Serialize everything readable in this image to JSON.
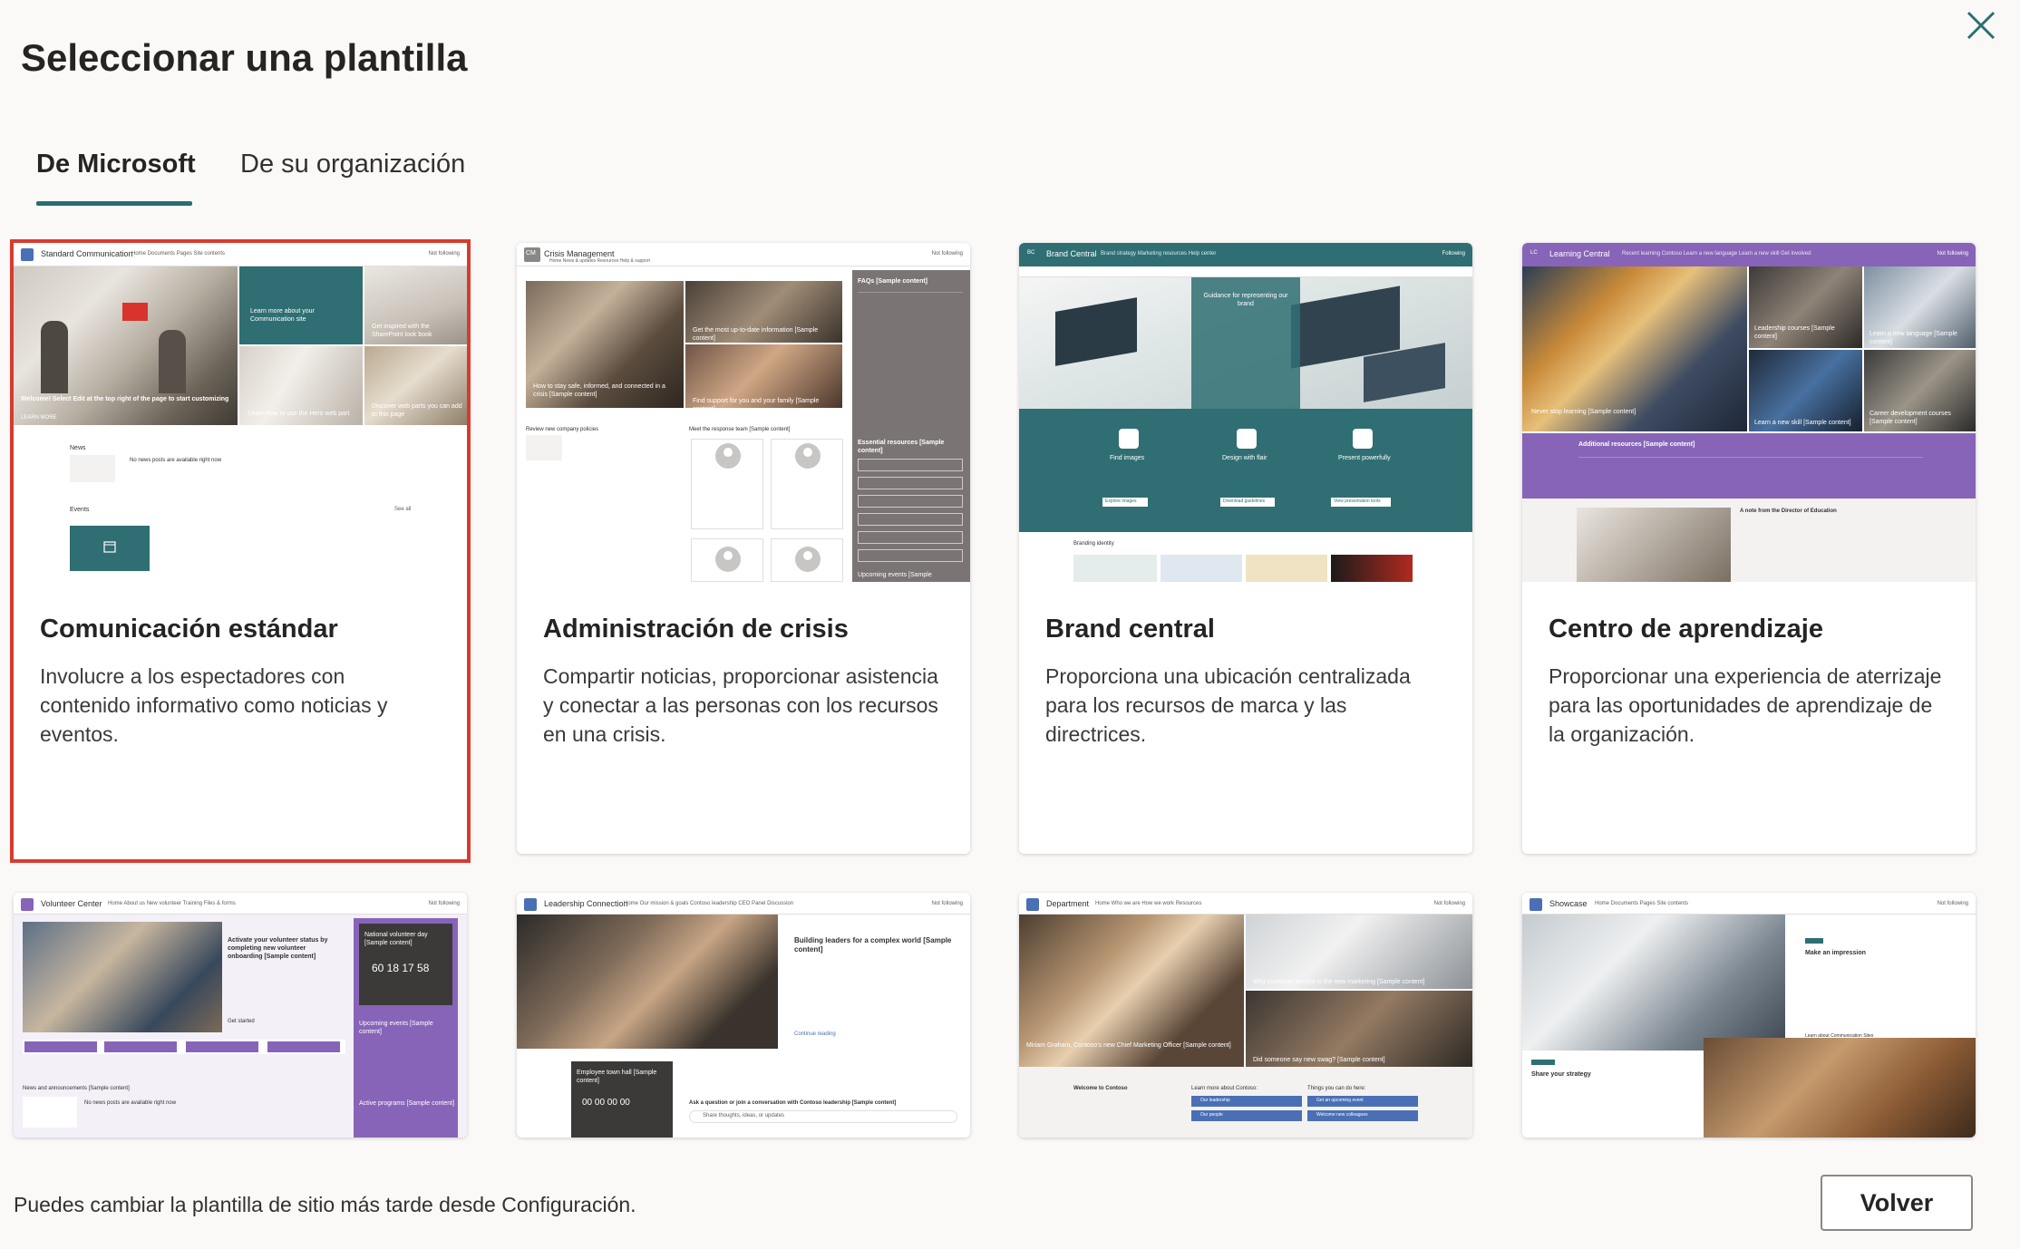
{
  "dialog": {
    "title": "Seleccionar una plantilla",
    "close_icon": "close-icon"
  },
  "tabs": [
    {
      "label": "De Microsoft",
      "active": true
    },
    {
      "label": "De su organización",
      "active": false
    }
  ],
  "templates": [
    {
      "title": "Comunicación estándar",
      "description": "Involucre a los espectadores con contenido informativo como noticias y eventos.",
      "selected": true,
      "preview": {
        "site_name": "Standard Communication",
        "nav": "Home   Documents   Pages   Site contents",
        "follow": "Not following",
        "hero_main": "Welcome! Select Edit at the top right of the page to start customizing",
        "hero_main_link": "LEARN MORE",
        "hero_top_right": "Learn more about your Communication site",
        "hero_tr2": "Get inspired with the SharePoint look book",
        "hero_br1": "Learn how to use the Hero web part",
        "hero_br2": "Discover web parts you can add to this page",
        "news_label": "News",
        "news_empty": "No news posts are available right now",
        "events_label": "Events",
        "see_all": "See all"
      }
    },
    {
      "title": "Administración de crisis",
      "description": "Compartir noticias, proporcionar asistencia y conectar a las personas con los recursos en una crisis.",
      "selected": false,
      "preview": {
        "site_name": "Crisis Management",
        "logo_text": "CM",
        "nav": "Home   News & updates   Resources   Help & support",
        "follow": "Not following",
        "hero_1": "How to stay safe, informed, and connected in a crisis [Sample content]",
        "hero_2": "Get the most up-to-date information [Sample content]",
        "hero_3": "Find support for you and your family [Sample content]",
        "faq_title": "FAQs [Sample content]",
        "review": "Review new company policies",
        "meet_team": "Meet the response team [Sample content]",
        "essential": "Essential resources [Sample content]",
        "upcoming": "Upcoming events [Sample"
      }
    },
    {
      "title": "Brand central",
      "description": "Proporciona una ubicación centralizada para los recursos de marca y las directrices.",
      "selected": false,
      "preview": {
        "site_name": "Brand Central",
        "logo_text": "BC",
        "nav": "Brand strategy   Marketing resources   Help center",
        "follow": "Following",
        "banner": "Guidance for representing our brand",
        "col1": "Find images",
        "col2": "Design with flair",
        "col3": "Present powerfully",
        "btn1": "Explore images",
        "btn2": "Download guidelines",
        "btn3": "View presentation tools",
        "branding": "Branding identity"
      }
    },
    {
      "title": "Centro de aprendizaje",
      "description": "Proporcionar una experiencia de aterrizaje para las oportunidades de aprendizaje de la organización.",
      "selected": false,
      "preview": {
        "site_name": "Learning Central",
        "logo_text": "LC",
        "nav": "Recent learning   Contoso   Learn a new language   Learn a new skill   Get involved",
        "follow": "Not following",
        "hero_main": "Never stop learning [Sample content]",
        "hero_2": "Leadership courses [Sample content]",
        "hero_3": "Learn a new language [Sample content]",
        "hero_4": "Learn a new skill [Sample content]",
        "hero_5": "Career development courses [Sample content]",
        "additional": "Additional resources [Sample content]",
        "note_title": "A note from the Director of Education"
      }
    },
    {
      "title": "Volunteer Center",
      "description": "",
      "selected": false,
      "preview": {
        "site_name": "Volunteer Center",
        "nav": "Home   About us   New volunteer   Training   Files & forms",
        "follow": "Not following",
        "activate": "Activate your volunteer status by completing new volunteer onboarding [Sample content]",
        "get_started": "Get started",
        "national_day": "National volunteer day [Sample content]",
        "count": "60  18  17  58",
        "upcoming": "Upcoming events [Sample content]",
        "news": "News and announcements [Sample content]",
        "news_empty": "No news posts are available right now",
        "active_programs": "Active programs [Sample content]"
      }
    },
    {
      "title": "Leadership Connection",
      "description": "",
      "selected": false,
      "preview": {
        "site_name": "Leadership Connection",
        "nav": "Home   Our mission & goals   Contoso leadership   CEO Panel Discussion",
        "follow": "Not following",
        "headline": "Building leaders for a complex world [Sample content]",
        "continue": "Continue reading",
        "townhall": "Employee town hall [Sample content]",
        "timer": "00  00  00  00",
        "ask": "Ask a question or join a conversation with Contoso leadership [Sample content]",
        "share": "Share thoughts, ideas, or updates"
      }
    },
    {
      "title": "Department",
      "description": "",
      "selected": false,
      "preview": {
        "site_name": "Department",
        "nav": "Home   Who we are   How we work   Resources",
        "follow": "Not following",
        "hero_main": "Miriam Graham, Contoso's new Chief Marketing Officer [Sample content]",
        "hero_2": "Why customer service is the new marketing [Sample content]",
        "hero_3": "Did someone say new swag? [Sample content]",
        "welcome": "Welcome to Contoso",
        "learn_more": "Learn more about Contoso:",
        "things": "Things you can do here:",
        "link1": "Our leadership",
        "link2": "Our people",
        "link3": "Get an upcoming event",
        "link4": "Welcome new colleagues"
      }
    },
    {
      "title": "Showcase",
      "description": "",
      "selected": false,
      "preview": {
        "site_name": "Showcase",
        "nav": "Home   Documents   Pages   Site contents",
        "follow": "Not following",
        "impression": "Make an impression",
        "learn_more": "Learn about Communication Sites",
        "strategy": "Share your strategy"
      }
    }
  ],
  "footer": {
    "note": "Puedes cambiar la plantilla de sitio más tarde desde Configuración.",
    "back_label": "Volver"
  },
  "colors": {
    "accent": "#2b6e6f",
    "selected_outline": "#d83b2e",
    "purple": "#8764b8",
    "teal": "#2f6f73",
    "gray_panel": "#7a7574"
  }
}
